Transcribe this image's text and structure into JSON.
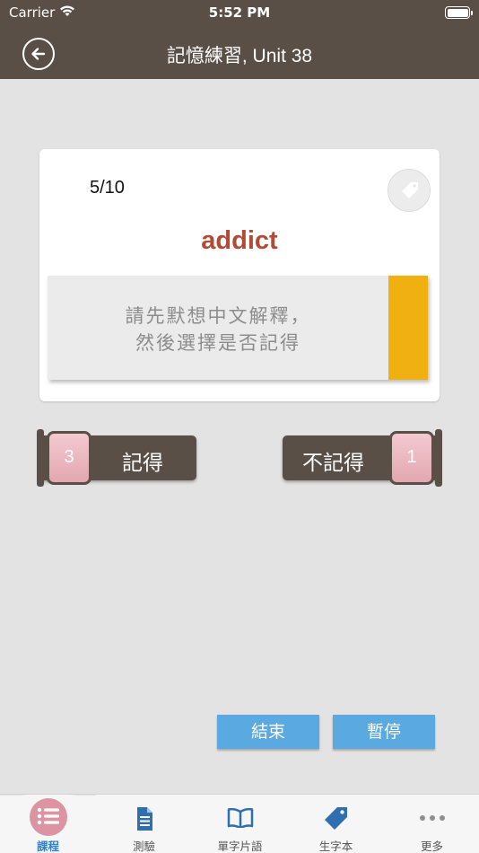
{
  "status": {
    "carrier": "Carrier",
    "time": "5:52 PM"
  },
  "nav": {
    "title": "記憶練習, Unit 38",
    "back_icon": "back-arrow-circle-icon"
  },
  "card": {
    "counter": "5/10",
    "word": "addict",
    "hint_line1": "請先默想中文解釋，",
    "hint_line2": "然後選擇是否記得",
    "tag_icon": "tag-icon"
  },
  "answers": {
    "remember": {
      "label": "記得",
      "count": "3"
    },
    "forget": {
      "label": "不記得",
      "count": "1"
    }
  },
  "actions": {
    "end_label": "結束",
    "pause_label": "暫停"
  },
  "tabs": [
    {
      "label": "課程",
      "icon": "list-icon",
      "active": true
    },
    {
      "label": "測驗",
      "icon": "document-icon",
      "active": false
    },
    {
      "label": "單字片語",
      "icon": "book-icon",
      "active": false
    },
    {
      "label": "生字本",
      "icon": "tag-icon",
      "active": false
    },
    {
      "label": "更多",
      "icon": "more-icon",
      "active": false
    }
  ],
  "colors": {
    "nav_bg": "#5a4f47",
    "word": "#b34a35",
    "strip": "#f0b012",
    "action_blue": "#5aa9e0",
    "badge_pink": "#e3a7b1",
    "tab_active": "#2f82c9"
  }
}
